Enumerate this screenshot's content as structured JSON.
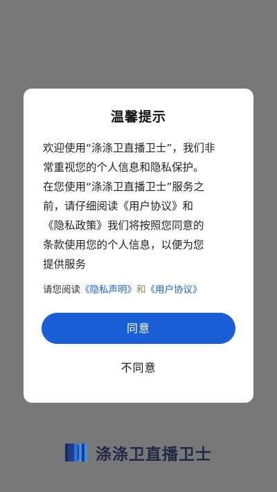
{
  "dialog": {
    "title": "温馨提示",
    "body_lines": [
      "欢迎使用“涤涤卫直播卫士”，我们非",
      "常重视您的个人信息和隐私保护。",
      "在您使用“涤涤卫直播卫士”服务之",
      "前，请仔细阅读《用户协议》和",
      "《隐私政策》我们将按照您同意的",
      "条款使用您的个人信息，以便为您",
      "提供服务"
    ],
    "consent": {
      "prefix": "请您阅读",
      "privacy_link": "《隐私声明》",
      "and": "和",
      "agreement_link": "《用户协议》"
    },
    "agree_label": "同意",
    "disagree_label": "不同意"
  },
  "brand": {
    "name": "涤涤卫直播卫士",
    "logo_icon": "brand-logo-icon"
  },
  "colors": {
    "overlay": "#787878",
    "accent": "#1a5fd6",
    "brand_text": "#1f2a45"
  }
}
